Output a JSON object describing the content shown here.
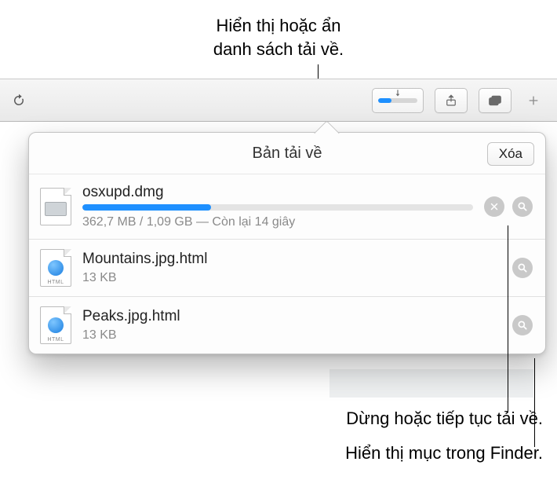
{
  "callouts": {
    "top": "Hiển thị hoặc ẩn\ndanh sách tải về.",
    "stop": "Dừng hoặc tiếp tục tải về.",
    "finder": "Hiển thị mục trong Finder."
  },
  "toolbar": {
    "download_progress_pct": 33
  },
  "popover": {
    "title": "Bản tải về",
    "clear_label": "Xóa"
  },
  "downloads": [
    {
      "name": "osxupd.dmg",
      "status": "362,7 MB / 1,09 GB — Còn lại 14 giây",
      "progress_pct": 33,
      "in_progress": true,
      "icon": "dmg"
    },
    {
      "name": "Mountains.jpg.html",
      "status": "13 KB",
      "in_progress": false,
      "icon": "html"
    },
    {
      "name": "Peaks.jpg.html",
      "status": "13 KB",
      "in_progress": false,
      "icon": "html"
    }
  ]
}
